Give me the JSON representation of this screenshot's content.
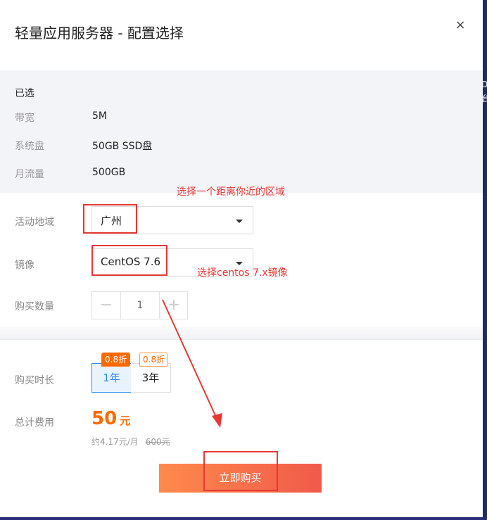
{
  "dialog": {
    "title": "轻量应用服务器 - 配置选择",
    "close_label": "×"
  },
  "selected": {
    "heading": "已选",
    "rows": [
      {
        "key": "带宽",
        "value": "5M"
      },
      {
        "key": "系统盘",
        "value": "50GB SSD盘"
      },
      {
        "key": "月流量",
        "value": "500GB"
      }
    ]
  },
  "region": {
    "label": "活动地域",
    "value": "广州"
  },
  "image": {
    "label": "镜像",
    "value": "CentOS 7.6"
  },
  "quantity": {
    "label": "购买数量",
    "value": "1",
    "minus": "−",
    "plus": "+"
  },
  "duration": {
    "label": "购买时长",
    "options": [
      {
        "label": "1年",
        "badge": "0.8折",
        "selected": true
      },
      {
        "label": "3年",
        "badge": "0.8折",
        "selected": false
      }
    ]
  },
  "total": {
    "label": "总计费用",
    "amount": "50",
    "unit": "元",
    "monthly": "约4.17元/月",
    "original": "600元"
  },
  "buy_button": "立即购买",
  "annotations": {
    "region_note": "选择一个距离你近的区域",
    "image_note": "选择centos 7.x镜像",
    "color": "#e53935"
  },
  "background_edge_text": "D 台"
}
